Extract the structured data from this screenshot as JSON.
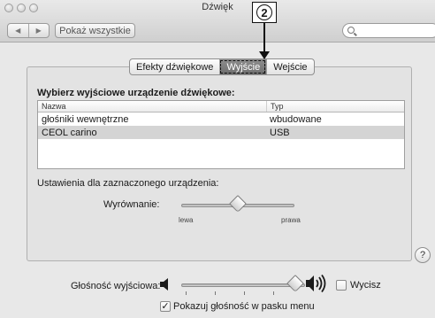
{
  "window": {
    "title": "Dźwięk"
  },
  "toolbar": {
    "back": "◀",
    "forward": "▶",
    "show_all": "Pokaż wszystkie",
    "search_placeholder": ""
  },
  "callout": {
    "number": "2"
  },
  "tabs": [
    {
      "label": "Efekty dźwiękowe",
      "active": false
    },
    {
      "label": "Wyjście",
      "active": true
    },
    {
      "label": "Wejście",
      "active": false
    }
  ],
  "output": {
    "heading": "Wybierz wyjściowe urządzenie dźwiękowe:",
    "columns": {
      "name": "Nazwa",
      "type": "Typ"
    },
    "rows": [
      {
        "name": "głośniki wewnętrzne",
        "type": "wbudowane",
        "selected": false
      },
      {
        "name": "CEOL carino",
        "type": "USB",
        "selected": true
      }
    ]
  },
  "settings": {
    "label": "Ustawienia dla zaznaczonego urządzenia:",
    "balance": {
      "label": "Wyrównanie:",
      "left": "lewa",
      "right": "prawa",
      "value": 0.5
    }
  },
  "help": {
    "label": "?"
  },
  "volume": {
    "label": "Głośność wyjściowa:",
    "value": 0.92,
    "mute_label": "Wycisz",
    "muted": false
  },
  "menubar": {
    "label": "Pokazuj głośność w pasku menu",
    "checked": true,
    "check_glyph": "✓"
  }
}
